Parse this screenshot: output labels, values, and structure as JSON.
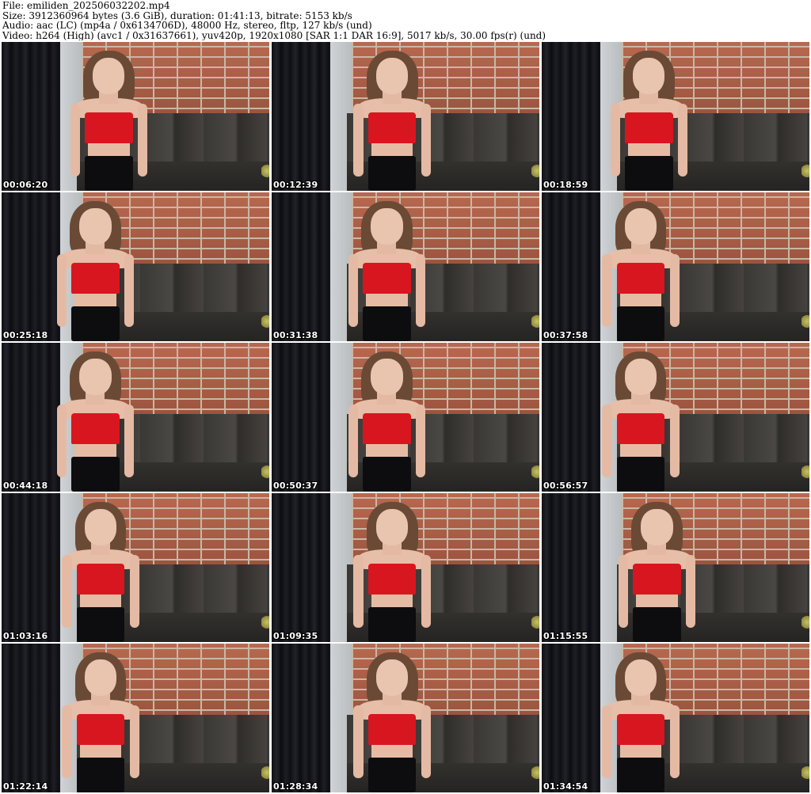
{
  "header": {
    "file_line": "File: emiliden_202506032202.mp4",
    "size_line": "Size: 3912360964 bytes (3.6 GiB), duration: 01:41:13, bitrate: 5153 kb/s",
    "audio_line": "Audio: aac (LC) (mp4a / 0x6134706D), 48000 Hz, stereo, fltp, 127 kb/s (und)",
    "video_line": "Video: h264 (High) (avc1 / 0x31637661), yuv420p, 1920x1080 [SAR 1:1 DAR 16:9], 5017 kb/s, 30.00 fps(r) (und)"
  },
  "thumbnails": [
    {
      "timestamp": "00:06:20"
    },
    {
      "timestamp": "00:12:39"
    },
    {
      "timestamp": "00:18:59"
    },
    {
      "timestamp": "00:25:18"
    },
    {
      "timestamp": "00:31:38"
    },
    {
      "timestamp": "00:37:58"
    },
    {
      "timestamp": "00:44:18"
    },
    {
      "timestamp": "00:50:37"
    },
    {
      "timestamp": "00:56:57"
    },
    {
      "timestamp": "01:03:16"
    },
    {
      "timestamp": "01:09:35"
    },
    {
      "timestamp": "01:15:55"
    },
    {
      "timestamp": "01:22:14"
    },
    {
      "timestamp": "01:28:34"
    },
    {
      "timestamp": "01:34:54"
    }
  ],
  "colors": {
    "background": "#ffffff",
    "timestamp_text": "#ffffff",
    "top_garment": "#d8161f"
  }
}
